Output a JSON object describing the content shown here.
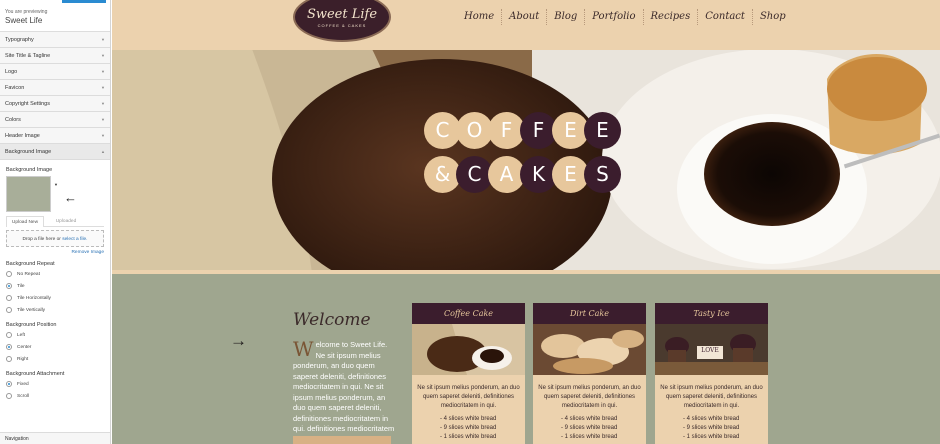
{
  "sidebar": {
    "previewing_label": "You are previewing",
    "site_name": "Sweet Life",
    "sections": [
      "Typography",
      "Site Title & Tagline",
      "Logo",
      "Favicon",
      "Copyright Settings",
      "Colors",
      "Header Image"
    ],
    "open_section": "Background Image",
    "bg_image_label": "Background Image",
    "tab_upload": "Upload New",
    "tab_uploaded": "Uploaded",
    "drop_text": "Drop a file here or ",
    "drop_link": "select a file.",
    "remove_link": "Remove Image",
    "repeat": {
      "label": "Background Repeat",
      "options": [
        "No Repeat",
        "Tile",
        "Tile Horizontally",
        "Tile Vertically"
      ],
      "selected": "Tile"
    },
    "position": {
      "label": "Background Position",
      "options": [
        "Left",
        "Center",
        "Right"
      ],
      "selected": "Center"
    },
    "attachment": {
      "label": "Background Attachment",
      "options": [
        "Fixed",
        "Scroll"
      ],
      "selected": "Fixed"
    },
    "bottom_section": "Navigation"
  },
  "site": {
    "logo_title": "Sweet Life",
    "logo_subtitle": "COFFEE & CAKES",
    "nav": [
      "Home",
      "About",
      "Blog",
      "Portfolio",
      "Recipes",
      "Contact",
      "Shop"
    ],
    "hero_row1": [
      "C",
      "O",
      "F",
      "F",
      "E",
      "E"
    ],
    "hero_row2": [
      "&",
      "C",
      "A",
      "K",
      "E",
      "S"
    ],
    "welcome_title": "Welcome",
    "welcome_dropcap": "W",
    "welcome_text": "elcome to Sweet Life. Ne sit ipsum melius ponderum, an duo quem saperet deleniti, definitiones mediocritatem in qui. Ne sit ipsum melius ponderum, an duo quem saperet deleniti, definitiones mediocritatem in qui. definitiones mediocritatem",
    "cards": [
      {
        "title": "Coffee Cake",
        "text": "Ne sit ipsum melius ponderum, an duo quem saperet deleniti, definitiones mediocritatem in qui.",
        "items": [
          "- 4 slices white bread",
          "- 9 slices white bread",
          "- 1 slices white bread"
        ]
      },
      {
        "title": "Dirt Cake",
        "text": "Ne sit ipsum melius ponderum, an duo quem saperet deleniti, definitiones mediocritatem in qui.",
        "items": [
          "- 4 slices white bread",
          "- 9 slices white bread",
          "- 1 slices white bread"
        ]
      },
      {
        "title": "Tasty Ice",
        "text": "Ne sit ipsum melius ponderum, an duo quem saperet deleniti, definitiones mediocritatem in qui.",
        "items": [
          "- 4 slices white bread",
          "- 9 slices white bread",
          "- 1 slices white bread"
        ]
      }
    ],
    "love_sign": "LOVE"
  },
  "colors": {
    "accent_blue": "#2a8bd1",
    "dark_plum": "#3b1d2d",
    "beige": "#e7c79c",
    "sage": "#9fa68f",
    "header_tan": "#ecd2ae"
  }
}
